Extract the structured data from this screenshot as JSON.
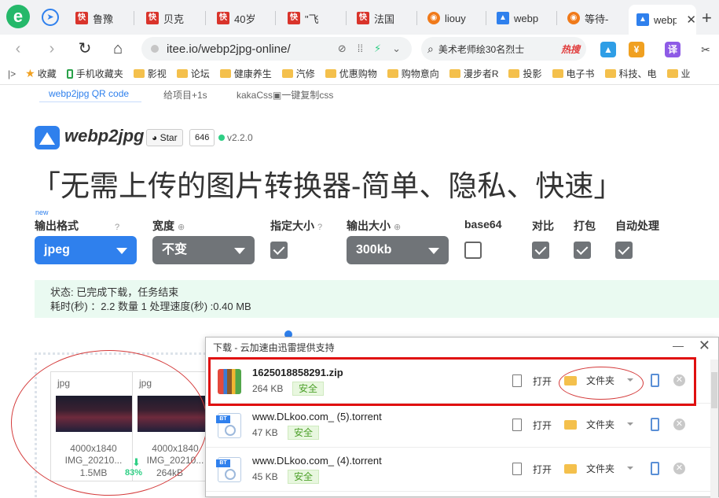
{
  "browser": {
    "tabs": [
      {
        "label": "鲁豫"
      },
      {
        "label": "贝克"
      },
      {
        "label": "40岁"
      },
      {
        "label": "\"飞"
      },
      {
        "label": "法国"
      },
      {
        "label": "liouy"
      },
      {
        "label": "webp"
      },
      {
        "label": "等待-"
      },
      {
        "label": "webp"
      }
    ],
    "url": "itee.io/webp2jpg-online/",
    "search_text": "美术老师绘30名烈士",
    "search_hot": "热搜",
    "ext_translate": "译"
  },
  "bookmarks": [
    {
      "label": "收藏"
    },
    {
      "label": "手机收藏夹"
    },
    {
      "label": "影视"
    },
    {
      "label": "论坛"
    },
    {
      "label": "健康养生"
    },
    {
      "label": "汽修"
    },
    {
      "label": "优惠购物"
    },
    {
      "label": "购物意向"
    },
    {
      "label": "漫步者R"
    },
    {
      "label": "投影"
    },
    {
      "label": "电子书"
    },
    {
      "label": "科技、电"
    },
    {
      "label": "业"
    }
  ],
  "subnav": {
    "qr": "webp2jpg QR code",
    "star": "给项目+1s",
    "css": "kakaCss▣一键复制css"
  },
  "header": {
    "brand": "webp2jpg",
    "star_label": "Star",
    "star_count": "646",
    "version": "v2.2.0",
    "headline": "「无需上传的图片转换器-简单、隐私、快速」"
  },
  "options": {
    "new_tag": "new",
    "format_label": "输出格式",
    "format_value": "jpeg",
    "width_label": "宽度",
    "width_value": "不变",
    "fixed_size_label": "指定大小",
    "output_size_label": "输出大小",
    "output_size_value": "300kb",
    "base64_label": "base64",
    "compare_label": "对比",
    "pack_label": "打包",
    "auto_label": "自动处理",
    "help": "?",
    "plus": "⊕"
  },
  "status": {
    "line1": "状态: 已完成下载，任务结束",
    "line2": "耗时(秒) ：2.2 数量 1 处理速度(秒) :0.40 MB"
  },
  "cards": [
    {
      "format": "jpg",
      "dims": "4000x1840",
      "name": "IMG_20210...",
      "size": "1.5MB"
    },
    {
      "format": "jpg",
      "dims": "4000x1840",
      "name": "IMG_20210...",
      "size": "264kB"
    }
  ],
  "savings": "83%",
  "download": {
    "title": "下载 - 云加速由迅雷提供支持",
    "open_label": "打开",
    "folder_label": "文件夹",
    "safe_label": "安全",
    "items": [
      {
        "name": "1625018858291.zip",
        "size": "264 KB"
      },
      {
        "name": "www.DLkoo.com_ (5).torrent",
        "size": "47 KB"
      },
      {
        "name": "www.DLkoo.com_ (4).torrent",
        "size": "45 KB"
      }
    ]
  }
}
